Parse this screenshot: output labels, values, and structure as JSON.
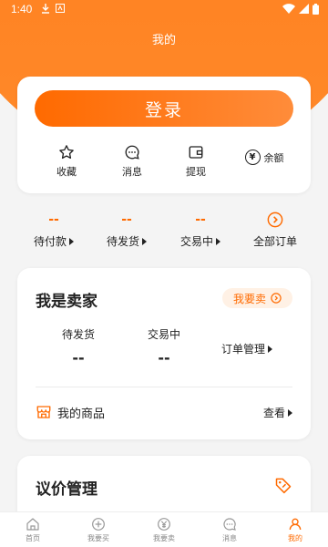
{
  "status_bar": {
    "time": "1:40"
  },
  "header": {
    "title": "我的"
  },
  "login_card": {
    "login_label": "登录",
    "quick_actions": [
      {
        "label": "收藏",
        "icon": "star-icon"
      },
      {
        "label": "消息",
        "icon": "chat-icon"
      },
      {
        "label": "提现",
        "icon": "wallet-icon"
      },
      {
        "label": "余额",
        "icon": "yen-icon",
        "symbol": "¥"
      }
    ]
  },
  "orders": {
    "items": [
      {
        "count": "--",
        "label": "待付款"
      },
      {
        "count": "--",
        "label": "待发货"
      },
      {
        "count": "--",
        "label": "交易中"
      },
      {
        "label": "全部订单"
      }
    ]
  },
  "seller": {
    "title": "我是卖家",
    "sell_button": "我要卖",
    "stats": [
      {
        "label": "待发货",
        "value": "--"
      },
      {
        "label": "交易中",
        "value": "--"
      }
    ],
    "order_manage": "订单管理",
    "goods_label": "我的商品",
    "goods_view": "查看"
  },
  "price_manage": {
    "title": "议价管理"
  },
  "tabbar": {
    "items": [
      {
        "label": "首页",
        "icon": "home-icon"
      },
      {
        "label": "我要买",
        "icon": "plus-circle-icon"
      },
      {
        "label": "我要卖",
        "icon": "yen-circle-icon"
      },
      {
        "label": "消息",
        "icon": "chat-icon"
      },
      {
        "label": "我的",
        "icon": "user-icon",
        "active": true
      }
    ]
  },
  "colors": {
    "accent": "#ff6a00",
    "background": "#f4f4f4"
  }
}
